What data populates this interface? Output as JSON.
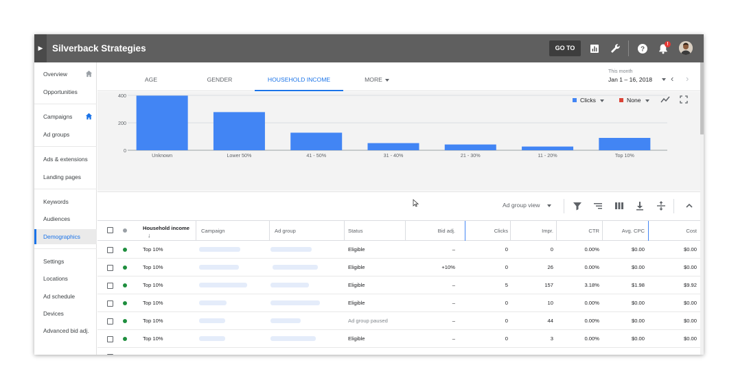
{
  "app": {
    "title": "Silverback Strategies",
    "goto_label": "GO TO",
    "notification_badge": "!",
    "icons": [
      "expand-arrow-icon",
      "reports-icon",
      "wrench-icon",
      "help-icon",
      "bell-icon",
      "avatar"
    ]
  },
  "sidebar": {
    "items": [
      {
        "label": "Overview",
        "home": true
      },
      {
        "label": "Opportunities"
      },
      {
        "label": "Campaigns",
        "home": true
      },
      {
        "label": "Ad groups"
      },
      {
        "label": "Ads & extensions"
      },
      {
        "label": "Landing pages"
      },
      {
        "label": "Keywords"
      },
      {
        "label": "Audiences"
      },
      {
        "label": "Demographics",
        "active": true
      },
      {
        "label": "Settings"
      },
      {
        "label": "Locations"
      },
      {
        "label": "Ad schedule"
      },
      {
        "label": "Devices"
      },
      {
        "label": "Advanced bid adj."
      }
    ]
  },
  "tabs": [
    {
      "label": "AGE"
    },
    {
      "label": "GENDER"
    },
    {
      "label": "HOUSEHOLD INCOME",
      "active": true
    },
    {
      "label": "MORE",
      "dropdown": true
    }
  ],
  "date": {
    "label": "This month",
    "range": "Jan 1 – 16, 2018",
    "prev_icon": "‹",
    "next_icon": "›"
  },
  "chart_controls": {
    "metric1": {
      "label": "Clicks",
      "color": "#4285f4"
    },
    "metric2": {
      "label": "None",
      "color": "#db4437"
    },
    "icons": [
      "line-chart-icon",
      "fullscreen-icon"
    ]
  },
  "chart_data": {
    "type": "bar",
    "categories": [
      "Unknown",
      "Lower 50%",
      "41 - 50%",
      "31 - 40%",
      "21 - 30%",
      "11 - 20%",
      "Top 10%"
    ],
    "series": [
      {
        "values": [
          398,
          278,
          128,
          52,
          42,
          27,
          90
        ]
      }
    ],
    "yticks": [
      0,
      200,
      400
    ],
    "ylim": [
      0,
      400
    ],
    "color": "#4285f4",
    "grid": true
  },
  "toolbar": {
    "view_label": "Ad group view",
    "icons": [
      "filter-icon",
      "segment-icon",
      "columns-icon",
      "download-icon",
      "expand-rows-icon",
      "collapse-icon"
    ]
  },
  "table": {
    "columns": {
      "household_income": "Household income",
      "sort_arrow": "↓",
      "campaign": "Campaign",
      "ad_group": "Ad group",
      "status": "Status",
      "bid_adj": "Bid adj.",
      "clicks": "Clicks",
      "impr": "Impr.",
      "ctr": "CTR",
      "avg_cpc": "Avg. CPC",
      "cost": "Cost"
    },
    "rows": [
      {
        "income": "Top 10%",
        "status": "Eligible",
        "bid_adj": "–",
        "clicks": "0",
        "impr": "0",
        "ctr": "0.00%",
        "avg_cpc": "$0.00",
        "cost": "$0.00"
      },
      {
        "income": "Top 10%",
        "status": "Eligible",
        "bid_adj": "+10%",
        "clicks": "0",
        "impr": "26",
        "ctr": "0.00%",
        "avg_cpc": "$0.00",
        "cost": "$0.00"
      },
      {
        "income": "Top 10%",
        "status": "Eligible",
        "bid_adj": "–",
        "clicks": "5",
        "impr": "157",
        "ctr": "3.18%",
        "avg_cpc": "$1.98",
        "cost": "$9.92"
      },
      {
        "income": "Top 10%",
        "status": "Eligible",
        "bid_adj": "–",
        "clicks": "0",
        "impr": "10",
        "ctr": "0.00%",
        "avg_cpc": "$0.00",
        "cost": "$0.00"
      },
      {
        "income": "Top 10%",
        "status": "Ad group paused",
        "paused": true,
        "bid_adj": "–",
        "clicks": "0",
        "impr": "44",
        "ctr": "0.00%",
        "avg_cpc": "$0.00",
        "cost": "$0.00"
      },
      {
        "income": "Top 10%",
        "status": "Eligible",
        "bid_adj": "–",
        "clicks": "0",
        "impr": "3",
        "ctr": "0.00%",
        "avg_cpc": "$0.00",
        "cost": "$0.00"
      }
    ]
  }
}
